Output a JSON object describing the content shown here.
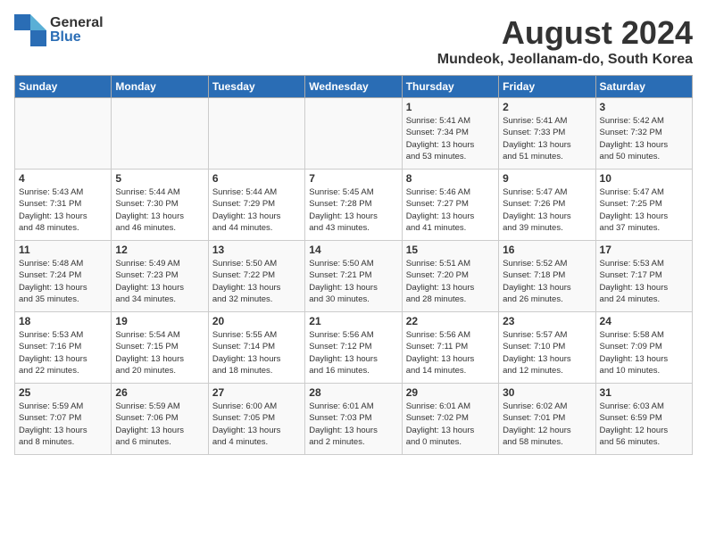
{
  "header": {
    "logo_general": "General",
    "logo_blue": "Blue",
    "month_year": "August 2024",
    "location": "Mundeok, Jeollanam-do, South Korea"
  },
  "days_of_week": [
    "Sunday",
    "Monday",
    "Tuesday",
    "Wednesday",
    "Thursday",
    "Friday",
    "Saturday"
  ],
  "weeks": [
    [
      {
        "day": "",
        "info": ""
      },
      {
        "day": "",
        "info": ""
      },
      {
        "day": "",
        "info": ""
      },
      {
        "day": "",
        "info": ""
      },
      {
        "day": "1",
        "info": "Sunrise: 5:41 AM\nSunset: 7:34 PM\nDaylight: 13 hours\nand 53 minutes."
      },
      {
        "day": "2",
        "info": "Sunrise: 5:41 AM\nSunset: 7:33 PM\nDaylight: 13 hours\nand 51 minutes."
      },
      {
        "day": "3",
        "info": "Sunrise: 5:42 AM\nSunset: 7:32 PM\nDaylight: 13 hours\nand 50 minutes."
      }
    ],
    [
      {
        "day": "4",
        "info": "Sunrise: 5:43 AM\nSunset: 7:31 PM\nDaylight: 13 hours\nand 48 minutes."
      },
      {
        "day": "5",
        "info": "Sunrise: 5:44 AM\nSunset: 7:30 PM\nDaylight: 13 hours\nand 46 minutes."
      },
      {
        "day": "6",
        "info": "Sunrise: 5:44 AM\nSunset: 7:29 PM\nDaylight: 13 hours\nand 44 minutes."
      },
      {
        "day": "7",
        "info": "Sunrise: 5:45 AM\nSunset: 7:28 PM\nDaylight: 13 hours\nand 43 minutes."
      },
      {
        "day": "8",
        "info": "Sunrise: 5:46 AM\nSunset: 7:27 PM\nDaylight: 13 hours\nand 41 minutes."
      },
      {
        "day": "9",
        "info": "Sunrise: 5:47 AM\nSunset: 7:26 PM\nDaylight: 13 hours\nand 39 minutes."
      },
      {
        "day": "10",
        "info": "Sunrise: 5:47 AM\nSunset: 7:25 PM\nDaylight: 13 hours\nand 37 minutes."
      }
    ],
    [
      {
        "day": "11",
        "info": "Sunrise: 5:48 AM\nSunset: 7:24 PM\nDaylight: 13 hours\nand 35 minutes."
      },
      {
        "day": "12",
        "info": "Sunrise: 5:49 AM\nSunset: 7:23 PM\nDaylight: 13 hours\nand 34 minutes."
      },
      {
        "day": "13",
        "info": "Sunrise: 5:50 AM\nSunset: 7:22 PM\nDaylight: 13 hours\nand 32 minutes."
      },
      {
        "day": "14",
        "info": "Sunrise: 5:50 AM\nSunset: 7:21 PM\nDaylight: 13 hours\nand 30 minutes."
      },
      {
        "day": "15",
        "info": "Sunrise: 5:51 AM\nSunset: 7:20 PM\nDaylight: 13 hours\nand 28 minutes."
      },
      {
        "day": "16",
        "info": "Sunrise: 5:52 AM\nSunset: 7:18 PM\nDaylight: 13 hours\nand 26 minutes."
      },
      {
        "day": "17",
        "info": "Sunrise: 5:53 AM\nSunset: 7:17 PM\nDaylight: 13 hours\nand 24 minutes."
      }
    ],
    [
      {
        "day": "18",
        "info": "Sunrise: 5:53 AM\nSunset: 7:16 PM\nDaylight: 13 hours\nand 22 minutes."
      },
      {
        "day": "19",
        "info": "Sunrise: 5:54 AM\nSunset: 7:15 PM\nDaylight: 13 hours\nand 20 minutes."
      },
      {
        "day": "20",
        "info": "Sunrise: 5:55 AM\nSunset: 7:14 PM\nDaylight: 13 hours\nand 18 minutes."
      },
      {
        "day": "21",
        "info": "Sunrise: 5:56 AM\nSunset: 7:12 PM\nDaylight: 13 hours\nand 16 minutes."
      },
      {
        "day": "22",
        "info": "Sunrise: 5:56 AM\nSunset: 7:11 PM\nDaylight: 13 hours\nand 14 minutes."
      },
      {
        "day": "23",
        "info": "Sunrise: 5:57 AM\nSunset: 7:10 PM\nDaylight: 13 hours\nand 12 minutes."
      },
      {
        "day": "24",
        "info": "Sunrise: 5:58 AM\nSunset: 7:09 PM\nDaylight: 13 hours\nand 10 minutes."
      }
    ],
    [
      {
        "day": "25",
        "info": "Sunrise: 5:59 AM\nSunset: 7:07 PM\nDaylight: 13 hours\nand 8 minutes."
      },
      {
        "day": "26",
        "info": "Sunrise: 5:59 AM\nSunset: 7:06 PM\nDaylight: 13 hours\nand 6 minutes."
      },
      {
        "day": "27",
        "info": "Sunrise: 6:00 AM\nSunset: 7:05 PM\nDaylight: 13 hours\nand 4 minutes."
      },
      {
        "day": "28",
        "info": "Sunrise: 6:01 AM\nSunset: 7:03 PM\nDaylight: 13 hours\nand 2 minutes."
      },
      {
        "day": "29",
        "info": "Sunrise: 6:01 AM\nSunset: 7:02 PM\nDaylight: 13 hours\nand 0 minutes."
      },
      {
        "day": "30",
        "info": "Sunrise: 6:02 AM\nSunset: 7:01 PM\nDaylight: 12 hours\nand 58 minutes."
      },
      {
        "day": "31",
        "info": "Sunrise: 6:03 AM\nSunset: 6:59 PM\nDaylight: 12 hours\nand 56 minutes."
      }
    ]
  ]
}
